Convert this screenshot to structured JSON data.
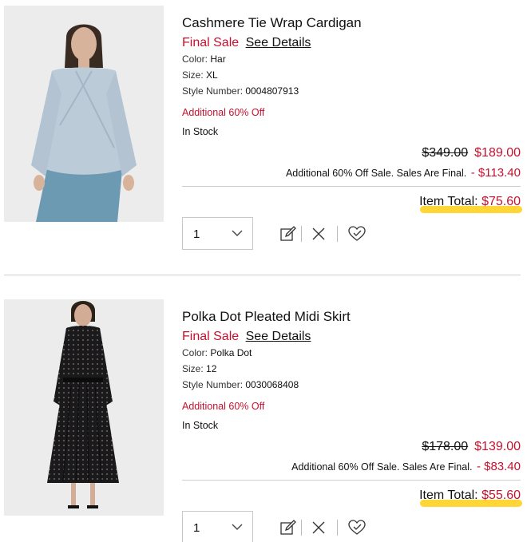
{
  "cart_items": [
    {
      "title": "Cashmere Tie Wrap Cardigan",
      "final_sale_label": "Final Sale",
      "see_details_label": "See Details",
      "color_label": "Color:",
      "color_value": "Har",
      "size_label": "Size:",
      "size_value": "XL",
      "style_label": "Style Number:",
      "style_value": "0004807913",
      "promo_text": "Additional 60% Off",
      "stock_status": "In Stock",
      "original_price": "$349.00",
      "sale_price": "$189.00",
      "discount_text": "Additional 60% Off Sale. Sales Are Final.",
      "discount_amount": "- $113.40",
      "item_total_label": "Item Total:",
      "item_total_value": "$75.60",
      "quantity": "1",
      "image_colors": {
        "background": "#ececec",
        "garment": "#bccbd8",
        "skirt": "#6d9ab3",
        "skin": "#d7b39b",
        "hair": "#3a2b22"
      }
    },
    {
      "title": "Polka Dot Pleated Midi Skirt",
      "final_sale_label": "Final Sale",
      "see_details_label": "See Details",
      "color_label": "Color:",
      "color_value": "Polka Dot",
      "size_label": "Size:",
      "size_value": "12",
      "style_label": "Style Number:",
      "style_value": "0030068408",
      "promo_text": "Additional 60% Off",
      "stock_status": "In Stock",
      "original_price": "$178.00",
      "sale_price": "$139.00",
      "discount_text": "Additional 60% Off Sale. Sales Are Final.",
      "discount_amount": "- $83.40",
      "item_total_label": "Item Total:",
      "item_total_value": "$55.60",
      "quantity": "1",
      "image_colors": {
        "background": "#ececec",
        "garment": "#1a1a1c",
        "dots": "#8a7d6e",
        "skin": "#d2ac94",
        "hair": "#2a2119"
      }
    }
  ],
  "icons": [
    "chevron-down-icon",
    "edit-icon",
    "remove-icon",
    "wishlist-heart-icon"
  ],
  "colors": {
    "sale_red": "#c8102e",
    "highlight_yellow": "#ffd21f",
    "divider": "#cfcfcf"
  }
}
